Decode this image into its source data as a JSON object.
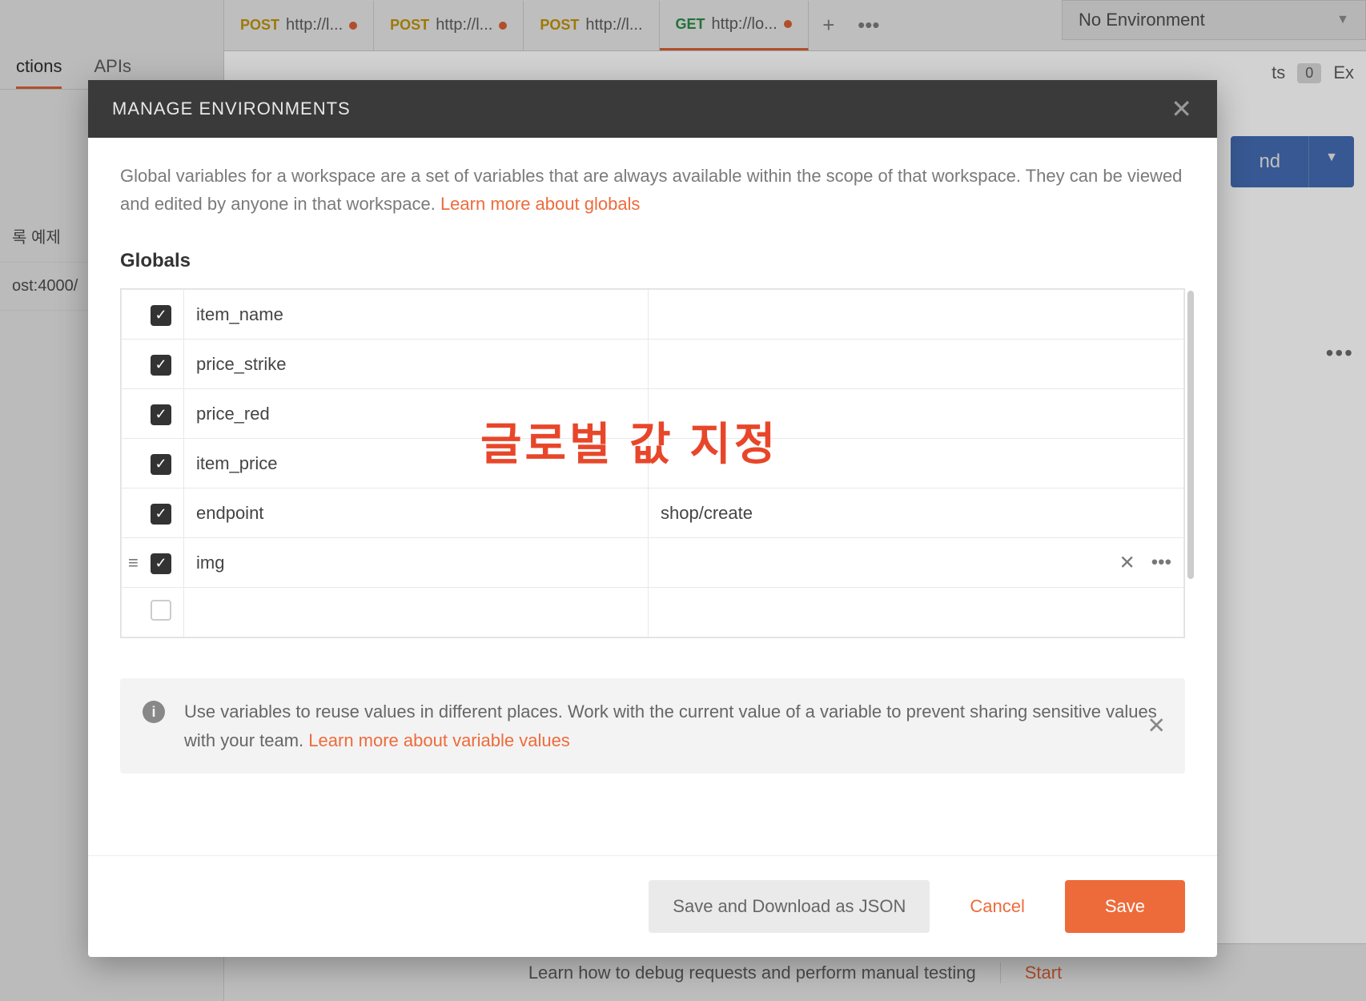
{
  "sidebar": {
    "tabs": [
      "ctions",
      "APIs"
    ],
    "items": [
      "록 예제",
      "ost:4000/"
    ]
  },
  "tabs": [
    {
      "method": "POST",
      "label": "http://l..."
    },
    {
      "method": "POST",
      "label": "http://l..."
    },
    {
      "method": "POST",
      "label": "http://l..."
    },
    {
      "method": "GET",
      "label": "http://lo..."
    }
  ],
  "env": {
    "label": "No Environment"
  },
  "header_right": {
    "comments_label": "ts",
    "comments_count": "0",
    "examples": "Ex"
  },
  "send": {
    "label": "nd"
  },
  "bootcamp": {
    "text": "Learn how to debug requests and perform manual testing",
    "action": "Start"
  },
  "modal": {
    "title": "MANAGE ENVIRONMENTS",
    "desc1": "Global variables for a workspace are a set of variables that are always available within the scope of that workspace. They can be viewed and edited by anyone in that workspace. ",
    "desc_link": "Learn more about globals",
    "section": "Globals",
    "rows": [
      {
        "checked": true,
        "name": "item_name",
        "value": ""
      },
      {
        "checked": true,
        "name": "price_strike",
        "value": ""
      },
      {
        "checked": true,
        "name": "price_red",
        "value": ""
      },
      {
        "checked": true,
        "name": "item_price",
        "value": ""
      },
      {
        "checked": true,
        "name": "endpoint",
        "value": "shop/create"
      },
      {
        "checked": true,
        "name": "img",
        "value": "",
        "active": true
      }
    ],
    "info": {
      "text1": "Use variables to reuse values in different places. Work with the current value of a variable to prevent sharing sensitive values with your team. ",
      "link": "Learn more about variable values"
    },
    "buttons": {
      "json": "Save and Download as JSON",
      "cancel": "Cancel",
      "save": "Save"
    }
  },
  "annotation": "글로벌 값 지정"
}
